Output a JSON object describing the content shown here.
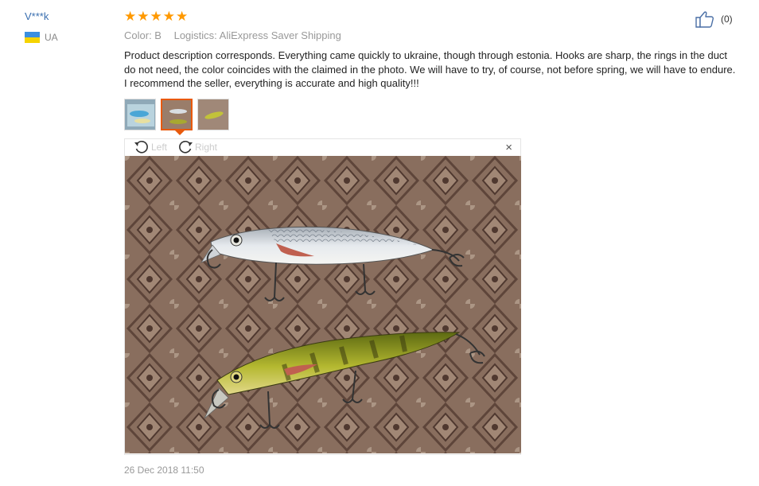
{
  "reviewer": {
    "name": "V***k",
    "country": "UA"
  },
  "rating": {
    "stars": 5,
    "max": 5
  },
  "helpful": {
    "count": "(0)"
  },
  "meta": {
    "color": "Color: B",
    "logistics": "Logistics: AliExpress Saver Shipping"
  },
  "review": {
    "text": "Product description corresponds. Everything came quickly to ukraine, though through estonia. Hooks are sharp, the rings in the duct do not need, the color coincides with the claimed in the photo. We will have to try, of course, not before spring, we will have to endure. I recommend the seller, everything is accurate and high quality!!!"
  },
  "viewer": {
    "rotate_left": "Left",
    "rotate_right": "Right",
    "close": "×"
  },
  "timestamp": "26 Dec 2018 11:50",
  "colors": {
    "accent": "#e8590c",
    "star": "#ff9900",
    "link": "#3a6fb0"
  }
}
